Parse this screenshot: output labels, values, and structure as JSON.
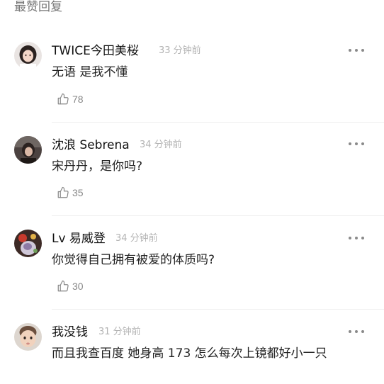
{
  "section": {
    "title": "最赞回复"
  },
  "comments": [
    {
      "username": "TWICE今田美桜",
      "time": "33 分钟前",
      "text": "无语 是我不懂",
      "likes": "78"
    },
    {
      "username": "沈浪 Sebrena",
      "time": "34 分钟前",
      "text": "宋丹丹，是你吗?",
      "likes": "35"
    },
    {
      "username": "Lv 易威登",
      "time": "34 分钟前",
      "text": "你觉得自己拥有被爱的体质吗?",
      "likes": "30"
    },
    {
      "username": "我没钱",
      "time": "31 分钟前",
      "text": "而且我查百度 她身高 173 怎么每次上镜都好小一只",
      "likes": ""
    }
  ],
  "colors": {
    "username": "#111111",
    "time": "#b3b3b3",
    "body_text": "#222222",
    "like_count": "#888888",
    "divider": "#eeeeee",
    "more_dots": "#8a8a8a"
  },
  "icons": {
    "like": "thumbs-up-icon",
    "more": "more-dots-icon"
  }
}
